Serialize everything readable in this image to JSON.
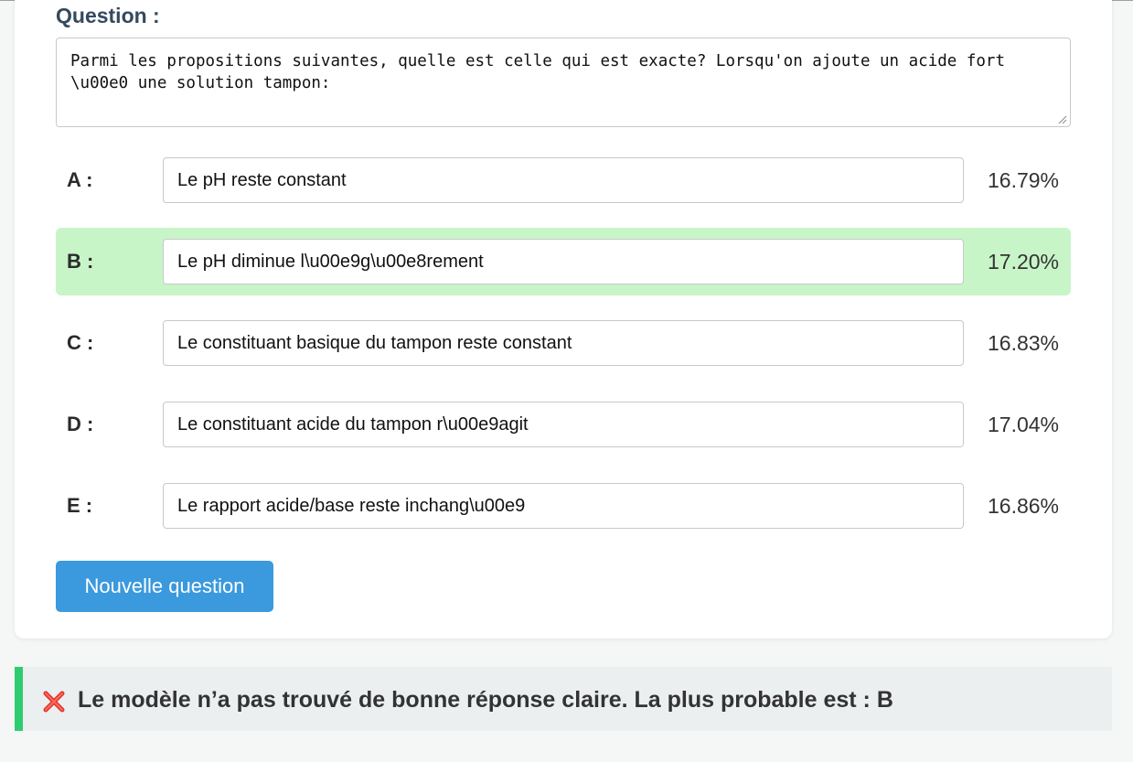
{
  "question": {
    "label": "Question :",
    "text": "Parmi les propositions suivantes, quelle est celle qui est exacte? Lorsqu'on ajoute un acide fort \\u00e0 une solution tampon:"
  },
  "options": [
    {
      "letter": "A :",
      "text": "Le pH reste constant",
      "percent": "16.79%",
      "highlighted": false
    },
    {
      "letter": "B :",
      "text": "Le pH diminue l\\u00e9g\\u00e8rement",
      "percent": "17.20%",
      "highlighted": true
    },
    {
      "letter": "C :",
      "text": "Le constituant basique du tampon reste constant",
      "percent": "16.83%",
      "highlighted": false
    },
    {
      "letter": "D :",
      "text": "Le constituant acide du tampon r\\u00e9agit",
      "percent": "17.04%",
      "highlighted": false
    },
    {
      "letter": "E :",
      "text": "Le rapport acide/base reste inchang\\u00e9",
      "percent": "16.86%",
      "highlighted": false
    }
  ],
  "buttons": {
    "new_question": "Nouvelle question"
  },
  "result": {
    "icon": "cross-mark-icon",
    "text": "Le modèle n’a pas trouvé de bonne réponse claire. La plus probable est : B"
  },
  "colors": {
    "highlight": "#c8f5c8",
    "button": "#3b99dd",
    "banner_border": "#2ecc71",
    "cross": "#e0342b"
  }
}
